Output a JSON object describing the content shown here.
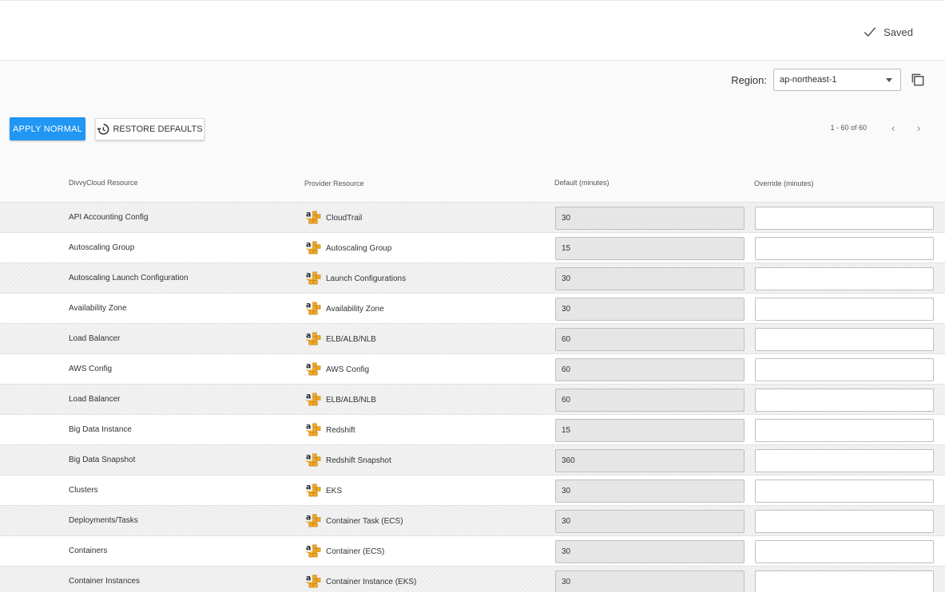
{
  "header": {
    "saved_label": "Saved"
  },
  "region": {
    "label": "Region:",
    "selected": "ap-northeast-1"
  },
  "toolbar": {
    "apply_label": "APPLY NORMAL",
    "restore_label": "RESTORE DEFAULTS"
  },
  "pagination": {
    "range": "1 - 60 of 60"
  },
  "table": {
    "headers": [
      "DivvyCloud Resource",
      "Provider Resource",
      "Default (minutes)",
      "Override (minutes)"
    ],
    "rows": [
      {
        "resource": "API Accounting Config",
        "provider": "CloudTrail",
        "default": "30",
        "override": ""
      },
      {
        "resource": "Autoscaling Group",
        "provider": "Autoscaling Group",
        "default": "15",
        "override": ""
      },
      {
        "resource": "Autoscaling Launch Configuration",
        "provider": "Launch Configurations",
        "default": "30",
        "override": ""
      },
      {
        "resource": "Availability Zone",
        "provider": "Availability Zone",
        "default": "30",
        "override": ""
      },
      {
        "resource": "Load Balancer",
        "provider": "ELB/ALB/NLB",
        "default": "60",
        "override": ""
      },
      {
        "resource": "AWS Config",
        "provider": "AWS Config",
        "default": "60",
        "override": ""
      },
      {
        "resource": "Load Balancer",
        "provider": "ELB/ALB/NLB",
        "default": "60",
        "override": ""
      },
      {
        "resource": "Big Data Instance",
        "provider": "Redshift",
        "default": "15",
        "override": ""
      },
      {
        "resource": "Big Data Snapshot",
        "provider": "Redshift Snapshot",
        "default": "360",
        "override": ""
      },
      {
        "resource": "Clusters",
        "provider": "EKS",
        "default": "30",
        "override": ""
      },
      {
        "resource": "Deployments/Tasks",
        "provider": "Container Task (ECS)",
        "default": "30",
        "override": ""
      },
      {
        "resource": "Containers",
        "provider": "Container (ECS)",
        "default": "30",
        "override": ""
      },
      {
        "resource": "Container Instances",
        "provider": "Container Instance (EKS)",
        "default": "30",
        "override": ""
      }
    ]
  },
  "icons": {
    "saved": "check-icon",
    "copy": "copy-icon",
    "restore": "history-icon",
    "provider": "aws-icon",
    "prev": "chevron-left-icon",
    "next": "chevron-right-icon",
    "dropdown": "caret-down-icon"
  },
  "colors": {
    "primary": "#2196f3"
  }
}
